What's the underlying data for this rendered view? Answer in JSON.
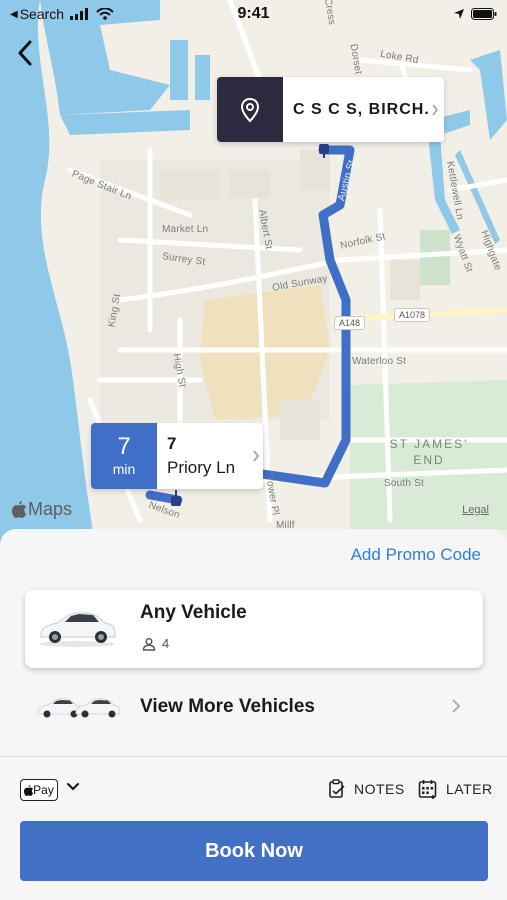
{
  "status_bar": {
    "back_label": "Search",
    "time": "9:41"
  },
  "map": {
    "streets": {
      "loke_rd": "Loke Rd",
      "page_stair_ln": "Page Stair Ln",
      "market_ln": "Market Ln",
      "surrey_st": "Surrey St",
      "albert_st": "Albert St",
      "norfolk_st": "Norfolk St",
      "old_sunway": "Old Sunway",
      "king_st": "King St",
      "high_st": "High St",
      "waterloo_st": "Waterloo St",
      "south_st": "South St",
      "tower_pl": "Tower Pl",
      "nelson": "Nelson",
      "kettlewell_ln": "Kettlewell Ln",
      "wyatt_st": "Wyatt St",
      "highgate": "Highgate",
      "austin_st": "Austin St",
      "dorset_st": "Dorset St",
      "cresswell": "Cress",
      "millfleet": "Millf"
    },
    "road_badges": {
      "a148": "A148",
      "a1078": "A1078"
    },
    "district": "ST JAMES'\nEND",
    "maps_brand": "Maps",
    "legal": "Legal"
  },
  "destination": {
    "name": "C S C S, BIRCH..."
  },
  "pickup": {
    "eta_value": "7",
    "eta_unit": "min",
    "address_number": "7",
    "address_street": "Priory Ln"
  },
  "sheet": {
    "promo_label": "Add Promo Code",
    "vehicle": {
      "name": "Any Vehicle",
      "seats": "4"
    },
    "more_vehicles_label": "View More Vehicles",
    "payment": {
      "method_label": "Pay"
    },
    "notes_label": "NOTES",
    "later_label": "LATER",
    "book_label": "Book Now"
  },
  "colors": {
    "accent": "#4270c4",
    "route": "#3f6fc7",
    "link": "#2f7fd9",
    "water": "#8fc9ea",
    "park": "#d9ead7"
  }
}
